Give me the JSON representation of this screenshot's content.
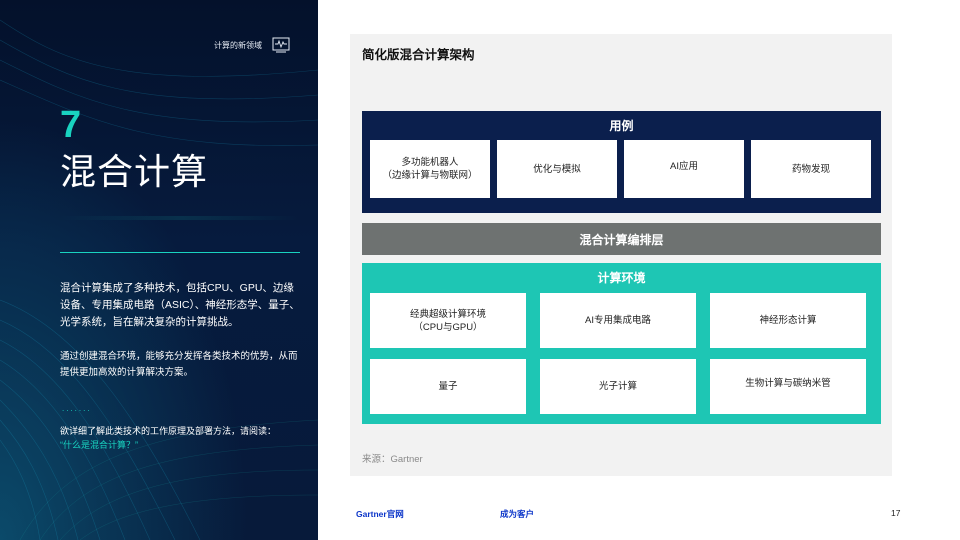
{
  "sidebar": {
    "section_label": "计算的新领域",
    "chapter_number": "7",
    "chapter_title": "混合计算",
    "paragraph_1": "混合计算集成了多种技术，包括CPU、GPU、边缘设备、专用集成电路（ASIC）、神经形态学、量子、光学系统，旨在解决复杂的计算挑战。",
    "paragraph_2": "通过创建混合环境，能够充分发挥各类技术的优势，从而提供更加高效的计算解决方案。",
    "dots": ".......",
    "read_more_prefix": "欲详细了解此类技术的工作原理及部署方法，请阅读：",
    "read_more_link": "“什么是混合计算？”",
    "accent_color": "#19d3c0"
  },
  "diagram": {
    "title": "简化版混合计算架构",
    "use_case_header": "用例",
    "use_cases": [
      {
        "line1": "多功能机器人",
        "line2": "（边缘计算与物联网）"
      },
      {
        "line1": "优化与模拟",
        "line2": ""
      },
      {
        "line1": "AI应用",
        "line2": ""
      },
      {
        "line1": "药物发现",
        "line2": ""
      }
    ],
    "orchestration_label": "混合计算编排层",
    "env_header": "计算环境",
    "env_items": [
      {
        "line1": "经典超级计算环境",
        "line2": "（CPU与GPU）"
      },
      {
        "line1": "AI专用集成电路",
        "line2": ""
      },
      {
        "line1": "神经形态计算",
        "line2": ""
      },
      {
        "line1": "量子",
        "line2": ""
      },
      {
        "line1": "光子计算",
        "line2": ""
      },
      {
        "line1": "生物计算与碳纳米管",
        "line2": ""
      }
    ],
    "source": "来源：Gartner",
    "colors": {
      "use_case_band": "#0b1f4d",
      "orchestration_band": "#6e7271",
      "env_band": "#1ec6b4",
      "card_bg": "#f2f2f2"
    }
  },
  "footer": {
    "link_1": "Gartner官网",
    "link_2": "成为客户",
    "page_number": "17",
    "link_color": "#0b35c9"
  }
}
